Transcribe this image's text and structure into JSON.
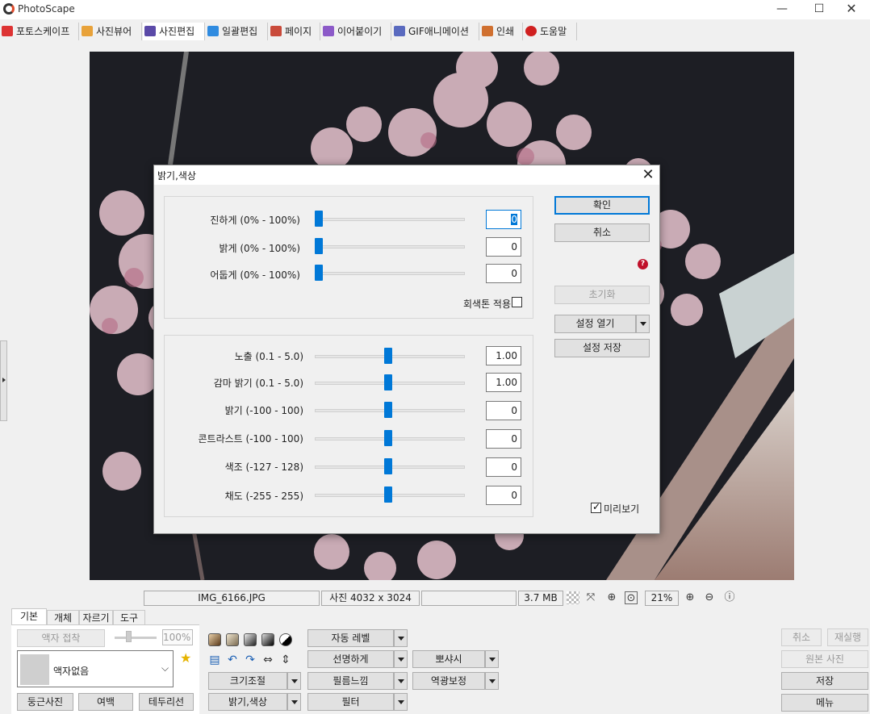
{
  "app": {
    "title": "PhotoScape"
  },
  "window_controls": {
    "minimize": "—",
    "maximize": "☐",
    "close": "✕"
  },
  "tabs": [
    {
      "label": "포토스케이프",
      "color": "#d33"
    },
    {
      "label": "사진뷰어",
      "color": "#e8a23a"
    },
    {
      "label": "사진편집",
      "color": "#5b4aa8"
    },
    {
      "label": "일괄편집",
      "color": "#2f8be0"
    },
    {
      "label": "페이지",
      "color": "#c94a3a"
    },
    {
      "label": "이어붙이기",
      "color": "#8c5ac8"
    },
    {
      "label": "GIF애니메이션",
      "color": "#5a6abf"
    },
    {
      "label": "인쇄",
      "color": "#d07030"
    },
    {
      "label": "도움말",
      "color": "#d02020"
    }
  ],
  "dialog": {
    "title": "밝기,색상",
    "close": "✕",
    "group1": {
      "sliders": [
        {
          "label": "진하게 (0% - 100%)",
          "value": "0",
          "fraction": 0.0
        },
        {
          "label": "밝게 (0% - 100%)",
          "value": "0",
          "fraction": 0.0
        },
        {
          "label": "어둡게 (0% - 100%)",
          "value": "0",
          "fraction": 0.0
        }
      ],
      "grayscale_label": "회색톤 적용",
      "grayscale_checked": false
    },
    "group2": {
      "sliders": [
        {
          "label": "노출 (0.1 - 5.0)",
          "value": "1.00",
          "fraction": 0.5
        },
        {
          "label": "감마 밝기 (0.1 - 5.0)",
          "value": "1.00",
          "fraction": 0.5
        },
        {
          "label": "밝기 (-100 - 100)",
          "value": "0",
          "fraction": 0.5
        },
        {
          "label": "콘트라스트 (-100 - 100)",
          "value": "0",
          "fraction": 0.5
        },
        {
          "label": "색조 (-127 - 128)",
          "value": "0",
          "fraction": 0.5
        },
        {
          "label": "채도 (-255 - 255)",
          "value": "0",
          "fraction": 0.5
        }
      ]
    },
    "buttons": {
      "ok": "확인",
      "cancel": "취소",
      "reset": "초기화",
      "open_settings": "설정 열기",
      "save_settings": "설정 저장"
    },
    "help": "?",
    "preview_label": "미리보기",
    "preview_checked": true
  },
  "status": {
    "filename": "IMG_6166.JPG",
    "dimensions": "사진 4032 x 3024",
    "filesize": "3.7 MB",
    "zoom": "21%"
  },
  "bottom": {
    "tabs": [
      "기본",
      "개체",
      "자르기",
      "도구"
    ],
    "frame_button": "액자 접착",
    "opacity": "100%",
    "frame_select": "액자없음",
    "round_photo": "둥근사진",
    "margin": "여백",
    "border": "테두리선",
    "resize": "크기조절",
    "brightness_color": "밝기,색상",
    "auto_level": "자동 레벨",
    "sharpen": "선명하게",
    "film_effect": "필름느낌",
    "filter": "필터",
    "bokeh": "뽀샤시",
    "backlight": "역광보정",
    "undo": "취소",
    "redo": "재실행",
    "original": "원본 사진",
    "save": "저장",
    "menu": "메뉴"
  }
}
